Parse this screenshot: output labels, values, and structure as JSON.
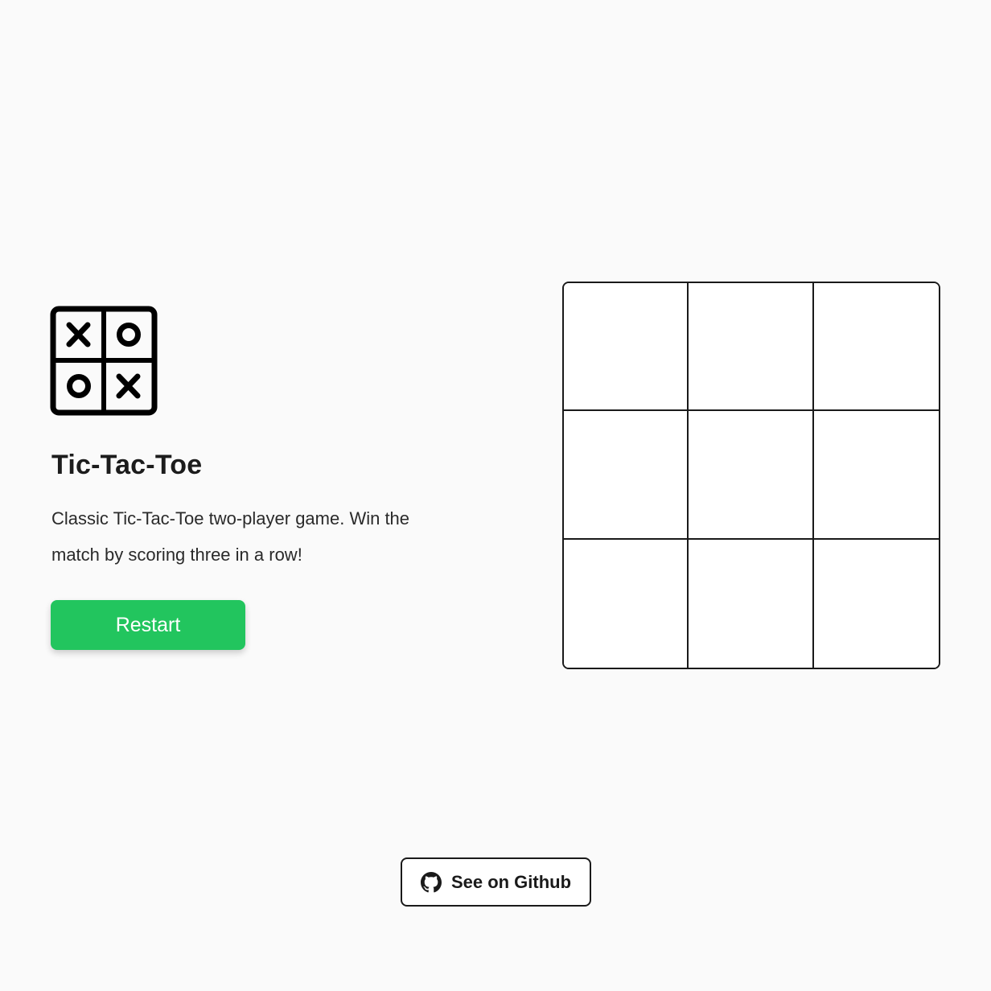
{
  "app": {
    "title": "Tic-Tac-Toe",
    "description": "Classic Tic-Tac-Toe two-player game. Win the match by scoring three in a row!",
    "logo_icon": "tic-tac-toe-logo-icon"
  },
  "controls": {
    "restart_label": "Restart"
  },
  "board": {
    "cells": [
      "",
      "",
      "",
      "",
      "",
      "",
      "",
      "",
      ""
    ]
  },
  "footer": {
    "github_label": "See on Github",
    "github_icon": "github-icon"
  },
  "colors": {
    "background": "#fafafa",
    "accent": "#22c55e",
    "border": "#1a1a1a",
    "board": "#ffffff"
  }
}
